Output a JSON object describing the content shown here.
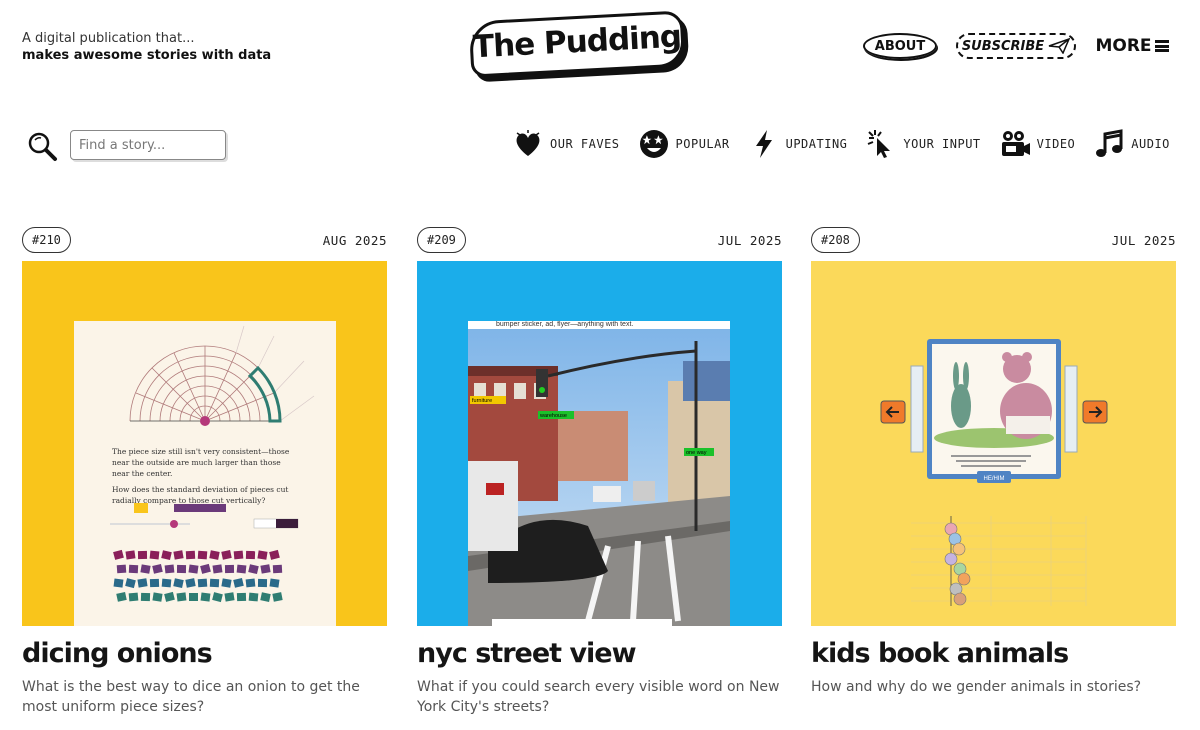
{
  "header": {
    "tagline_line1": "A digital publication that...",
    "tagline_line2": "makes awesome stories with data",
    "logo_text": "The Pudding",
    "about_label": "ABOUT",
    "subscribe_label": "SUBSCRIBE",
    "more_label": "MORE"
  },
  "search": {
    "placeholder": "Find a story..."
  },
  "filters": [
    {
      "label": "OUR FAVES",
      "icon": "heart-icon"
    },
    {
      "label": "POPULAR",
      "icon": "star-eyes-face-icon"
    },
    {
      "label": "UPDATING",
      "icon": "lightning-bolt-icon"
    },
    {
      "label": "YOUR INPUT",
      "icon": "cursor-click-icon"
    },
    {
      "label": "VIDEO",
      "icon": "video-camera-icon"
    },
    {
      "label": "AUDIO",
      "icon": "music-notes-icon"
    }
  ],
  "stories": [
    {
      "number": "#210",
      "date": "AUG 2025",
      "title": "dicing onions",
      "description": "What is the best way to dice an onion to get the most uniform piece sizes?",
      "bg_color": "#f9c51b"
    },
    {
      "number": "#209",
      "date": "JUL 2025",
      "title": "nyc street view",
      "description": "What if you could search every visible word on New York City's streets?",
      "bg_color": "#1badea"
    },
    {
      "number": "#208",
      "date": "JUL 2025",
      "title": "kids book animals",
      "description": "How and why do we gender animals in stories?",
      "bg_color": "#fbd95a"
    }
  ],
  "thumb_text": {
    "onion_para1": "The piece size still isn't very consistent—those near the outside are much larger than those near the center.",
    "onion_para2": "How does the standard deviation of pieces cut radially compare to those cut vertically?",
    "street_caption": "bumper sticker, ad, flyer—anything with text.",
    "street_tag1": "furniture",
    "street_tag2": "warehouse",
    "street_tag3": "one way",
    "kids_button": "HE/HIM"
  }
}
